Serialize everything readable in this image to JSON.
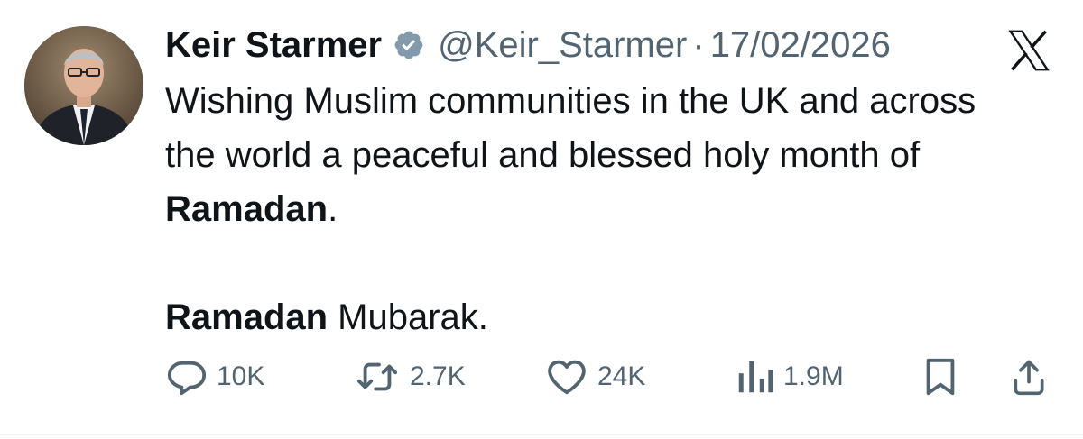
{
  "colors": {
    "text": "#0f1419",
    "secondary": "#536471",
    "verified_badge": "#829aab"
  },
  "author": {
    "name": "Keir Starmer",
    "handle": "@Keir_Starmer",
    "separator": "·",
    "date": "17/02/2026",
    "verified_icon": "verified-badge-icon",
    "avatar_icon": "avatar-photo"
  },
  "platform": {
    "logo_icon": "x-logo-icon"
  },
  "tweet": {
    "p1_text": "Wishing Muslim communities in the UK and across the world a peaceful and blessed holy month of ",
    "p1_bold": "Ramadan",
    "p1_end": ".",
    "p2_bold": "Ramadan",
    "p2_text": " Mubarak."
  },
  "actions": {
    "replies": {
      "icon": "reply-icon",
      "count": "10K"
    },
    "reposts": {
      "icon": "repost-icon",
      "count": "2.7K"
    },
    "likes": {
      "icon": "heart-icon",
      "count": "24K"
    },
    "views": {
      "icon": "views-icon",
      "count": "1.9M"
    },
    "bookmark": {
      "icon": "bookmark-icon"
    },
    "share": {
      "icon": "share-icon"
    }
  }
}
